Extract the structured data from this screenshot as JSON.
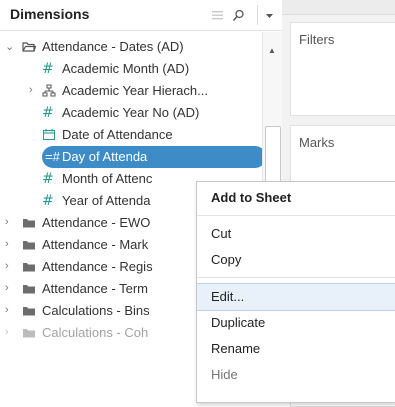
{
  "panel": {
    "title": "Dimensions"
  },
  "tree": [
    {
      "label": "Attendance - Dates (AD)",
      "icon": "folder-open-icon",
      "expanded": true
    },
    {
      "label": "Academic Month (AD)",
      "icon": "hash-icon"
    },
    {
      "label": "Academic Year Hierach...",
      "icon": "hierarchy-icon"
    },
    {
      "label": "Academic Year No (AD)",
      "icon": "hash-icon"
    },
    {
      "label": "Date of Attendance",
      "icon": "calendar-icon"
    },
    {
      "label": "Day of Attenda",
      "icon": "hash-link-icon",
      "selected": true
    },
    {
      "label": "Month of Attenc",
      "icon": "hash-icon"
    },
    {
      "label": "Year of Attenda",
      "icon": "hash-icon"
    },
    {
      "label": "Attendance - EWO",
      "icon": "folder-icon"
    },
    {
      "label": "Attendance - Mark",
      "icon": "folder-icon"
    },
    {
      "label": "Attendance - Regis",
      "icon": "folder-icon"
    },
    {
      "label": "Attendance - Term",
      "icon": "folder-icon"
    },
    {
      "label": "Calculations - Bins",
      "icon": "folder-icon"
    },
    {
      "label": "Calculations - Coh",
      "icon": "folder-icon"
    }
  ],
  "shelves": {
    "filters": "Filters",
    "marks": "Marks"
  },
  "context_menu": {
    "add_to_sheet": "Add to Sheet",
    "cut": "Cut",
    "copy": "Copy",
    "edit": "Edit...",
    "duplicate": "Duplicate",
    "rename": "Rename",
    "hide": "Hide"
  },
  "colors": {
    "selection": "#3d8cc7",
    "hash_green": "#2a9d8f",
    "menu_hover": "#e8f1fa"
  }
}
